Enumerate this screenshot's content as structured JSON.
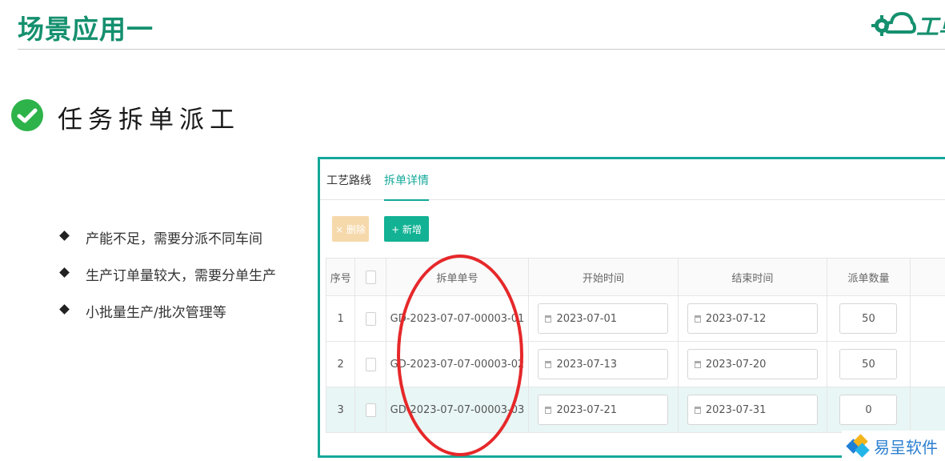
{
  "header": {
    "title": "场景应用一",
    "logo_text": "工单"
  },
  "section": {
    "title": "任务拆单派工",
    "bullets": [
      "产能不足，需要分派不同车间",
      "生产订单量较大，需要分单生产",
      "小批量生产/批次管理等"
    ]
  },
  "panel": {
    "tabs": [
      "工艺路线",
      "拆单详情"
    ],
    "active_tab": "拆单详情",
    "buttons": {
      "delete_label": "× 删除",
      "add_label": "+ 新增"
    },
    "columns": [
      "序号",
      "",
      "拆单单号",
      "开始时间",
      "结束时间",
      "派单数量"
    ],
    "rows": [
      {
        "index": "1",
        "order_no": "GD-2023-07-07-00003-01",
        "start": "2023-07-01",
        "end": "2023-07-12",
        "qty": "50"
      },
      {
        "index": "2",
        "order_no": "GD-2023-07-07-00003-02",
        "start": "2023-07-13",
        "end": "2023-07-20",
        "qty": "50"
      },
      {
        "index": "3",
        "order_no": "GD-2023-07-07-00003-03",
        "start": "2023-07-21",
        "end": "2023-07-31",
        "qty": "0"
      }
    ]
  },
  "watermark": {
    "text": "易呈软件"
  },
  "colors": {
    "brand_green": "#15906f",
    "panel_border": "#14a89a",
    "accent_teal": "#13b294",
    "annotation_red": "#e6282a",
    "check_green": "#2db34a"
  },
  "icons": [
    "gear-cloud-logo-icon",
    "check-circle-icon",
    "diamond-bullet-icon",
    "calendar-icon",
    "checkbox-icon",
    "yichen-logo-icon"
  ]
}
